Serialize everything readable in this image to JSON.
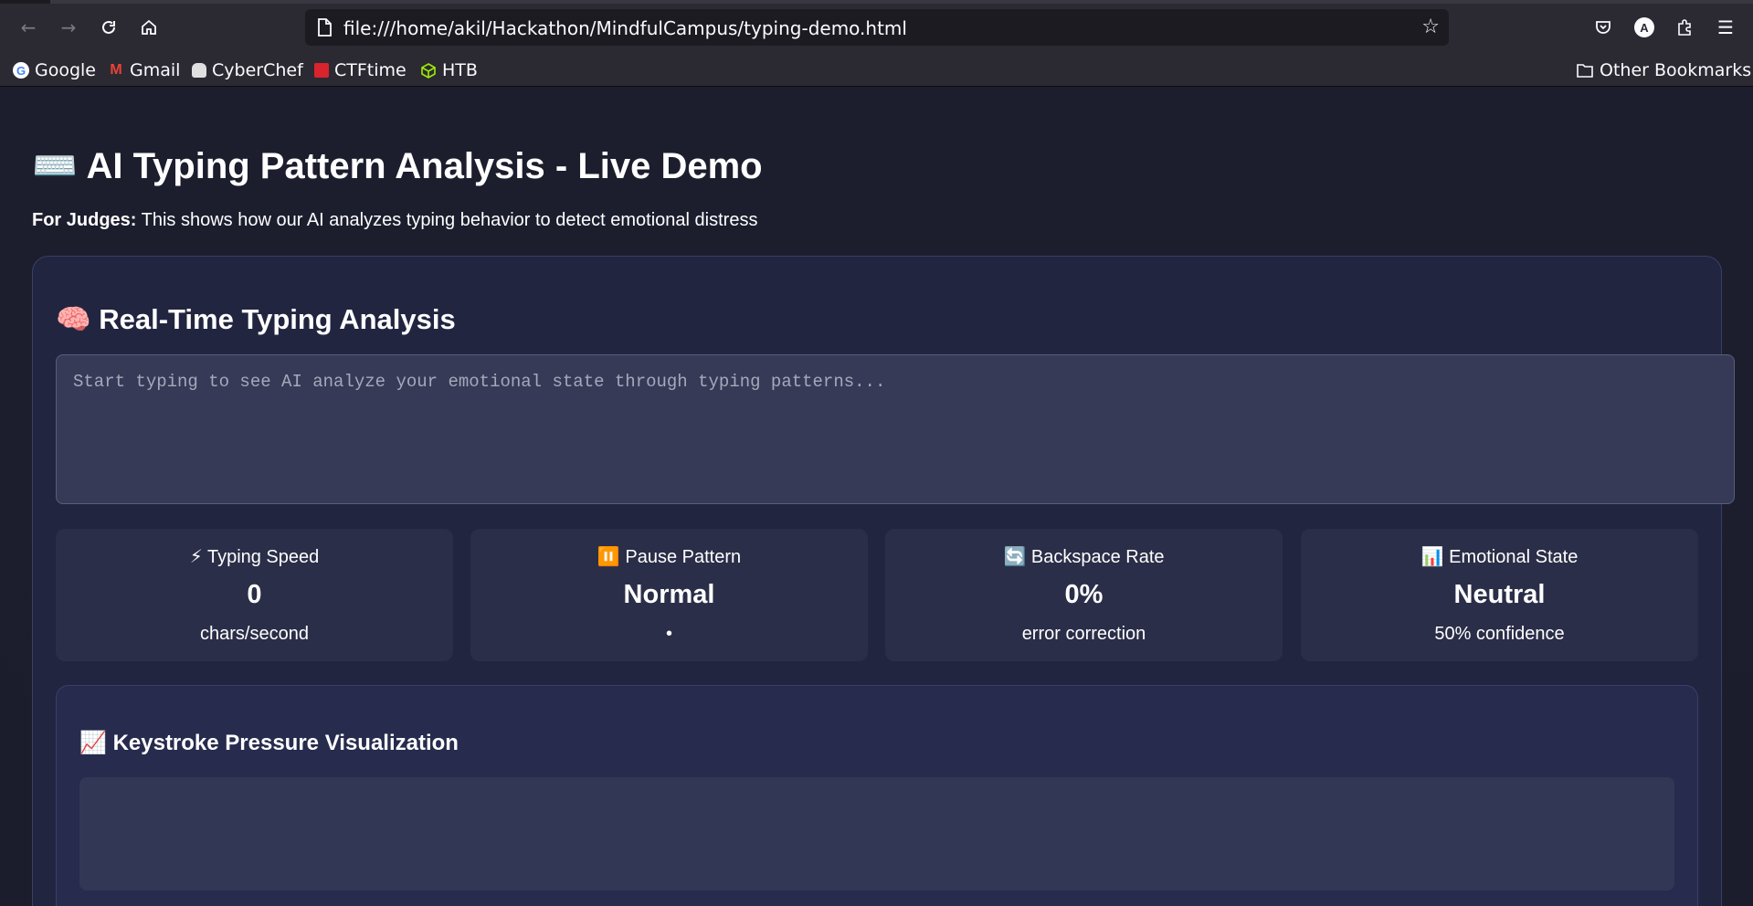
{
  "browser": {
    "url": "file:///home/akil/Hackathon/MindfulCampus/typing-demo.html",
    "nav": {
      "back_icon": "arrow-left-icon",
      "forward_icon": "arrow-right-icon",
      "reload_icon": "reload-icon",
      "home_icon": "home-icon"
    },
    "toolbar_icons": [
      "pocket-icon",
      "account-icon",
      "extensions-icon",
      "menu-icon"
    ],
    "bookmarks": [
      {
        "label": "Google",
        "icon": "google-icon",
        "color": "#4285f4"
      },
      {
        "label": "Gmail",
        "icon": "gmail-icon",
        "color": "#ea4335"
      },
      {
        "label": "CyberChef",
        "icon": "chef-hat-icon",
        "color": "#e0e0e0"
      },
      {
        "label": "CTFtime",
        "icon": "ctftime-icon",
        "color": "#d9232d"
      },
      {
        "label": "HTB",
        "icon": "htb-cube-icon",
        "color": "#9fef00"
      }
    ],
    "other_bookmarks": "Other Bookmarks"
  },
  "page": {
    "title_icon": "⌨️",
    "title": "AI Typing Pattern Analysis - Live Demo",
    "subtitle_label": "For Judges:",
    "subtitle_text": " This shows how our AI analyzes typing behavior to detect emotional distress",
    "panel": {
      "icon": "🧠",
      "title": "Real-Time Typing Analysis",
      "placeholder": "Start typing to see AI analyze your emotional state through typing patterns...",
      "value": ""
    },
    "metrics": [
      {
        "icon": "⚡",
        "label": "Typing Speed",
        "value": "0",
        "sub": "chars/second"
      },
      {
        "icon": "⏸️",
        "label": "Pause Pattern",
        "value": "Normal",
        "sub": "•"
      },
      {
        "icon": "🔄",
        "label": "Backspace Rate",
        "value": "0%",
        "sub": "error correction"
      },
      {
        "icon": "📊",
        "label": "Emotional State",
        "value": "Neutral",
        "sub": "50% confidence"
      }
    ],
    "visualization": {
      "icon": "📈",
      "title": "Keystroke Pressure Visualization"
    }
  }
}
